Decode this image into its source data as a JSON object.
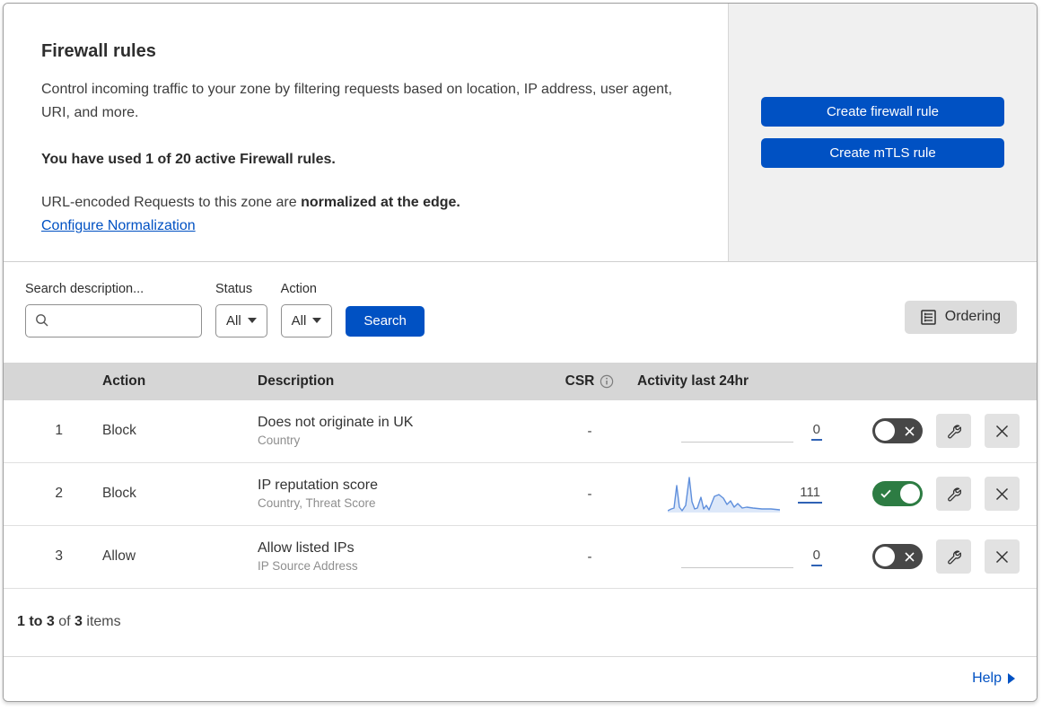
{
  "panel": {
    "title": "Firewall rules",
    "description": "Control incoming traffic to your zone by filtering requests based on location, IP address, user agent, URI, and more.",
    "usage": "You have used 1 of 20 active Firewall rules.",
    "normalization_text": "URL-encoded Requests to this zone are ",
    "normalization_bold": "normalized at the edge.",
    "normalization_link": "Configure Normalization",
    "buttons": {
      "create_firewall": "Create firewall rule",
      "create_mtls": "Create mTLS rule"
    }
  },
  "filters": {
    "search_label": "Search description...",
    "status_label": "Status",
    "status_value": "All",
    "action_label": "Action",
    "action_value": "All",
    "search_button": "Search",
    "ordering_button": "Ordering"
  },
  "table": {
    "headers": {
      "action": "Action",
      "description": "Description",
      "csr": "CSR",
      "activity": "Activity last 24hr"
    },
    "rows": [
      {
        "num": "1",
        "action": "Block",
        "title": "Does not originate in UK",
        "fields": "Country",
        "csr": "-",
        "count": "0",
        "enabled": false
      },
      {
        "num": "2",
        "action": "Block",
        "title": "IP reputation score",
        "fields": "Country, Threat Score",
        "csr": "-",
        "count": "111",
        "enabled": true,
        "sparkline_points": [
          [
            0,
            40
          ],
          [
            4,
            38
          ],
          [
            7,
            37
          ],
          [
            10,
            12
          ],
          [
            13,
            36
          ],
          [
            16,
            40
          ],
          [
            20,
            34
          ],
          [
            24,
            3
          ],
          [
            27,
            30
          ],
          [
            30,
            38
          ],
          [
            33,
            37
          ],
          [
            37,
            25
          ],
          [
            40,
            38
          ],
          [
            43,
            34
          ],
          [
            46,
            39
          ],
          [
            52,
            24
          ],
          [
            57,
            22
          ],
          [
            62,
            26
          ],
          [
            66,
            33
          ],
          [
            70,
            29
          ],
          [
            74,
            36
          ],
          [
            78,
            32
          ],
          [
            83,
            37
          ],
          [
            88,
            36
          ],
          [
            95,
            37
          ],
          [
            105,
            38
          ],
          [
            115,
            38
          ],
          [
            125,
            39
          ]
        ]
      },
      {
        "num": "3",
        "action": "Allow",
        "title": "Allow listed IPs",
        "fields": "IP Source Address",
        "csr": "-",
        "count": "0",
        "enabled": false
      }
    ]
  },
  "footer": {
    "range": "1 to 3",
    "of": "of",
    "total": "3",
    "items": "items",
    "help": "Help"
  },
  "colors": {
    "accent_blue": "#0051c3",
    "toggle_on_green": "#2d7c43",
    "toggle_off_gray": "#474747",
    "sparkline_blue": "#5f8fdc",
    "table_header_bg": "#d6d6d6"
  }
}
